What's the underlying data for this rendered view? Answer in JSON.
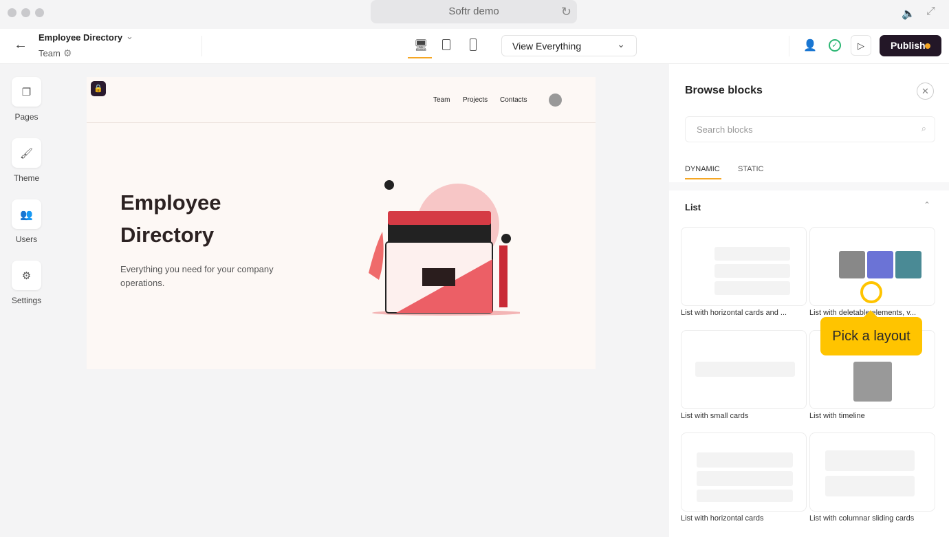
{
  "window": {
    "title": "Softr demo"
  },
  "header": {
    "app_name": "Employee Directory",
    "page_name": "Team",
    "view_select": "View Everything",
    "publish_label": "Publish",
    "accent": "#f5a623",
    "publish_bg": "#231727"
  },
  "sidebar": {
    "items": [
      {
        "label": "Pages",
        "icon": "pages-icon"
      },
      {
        "label": "Theme",
        "icon": "paint-roller-icon"
      },
      {
        "label": "Users",
        "icon": "users-icon"
      },
      {
        "label": "Settings",
        "icon": "gear-icon"
      }
    ]
  },
  "preview": {
    "nav": [
      "Team",
      "Projects",
      "Contacts"
    ],
    "hero_title_1": "Employee",
    "hero_title_2": "Directory",
    "hero_subtitle_1": "Everything you need for your company",
    "hero_subtitle_2": "operations."
  },
  "panel": {
    "title": "Browse blocks",
    "search_placeholder": "Search blocks",
    "tabs": [
      "DYNAMIC",
      "STATIC"
    ],
    "section": "List",
    "blocks": [
      "List with horizontal cards and ...",
      "List with deletable elements, v...",
      "List with small cards",
      "List with timeline",
      "List with horizontal cards",
      "List with columnar sliding cards"
    ]
  },
  "tooltip": {
    "text": "Pick a layout",
    "color": "#ffc400"
  }
}
